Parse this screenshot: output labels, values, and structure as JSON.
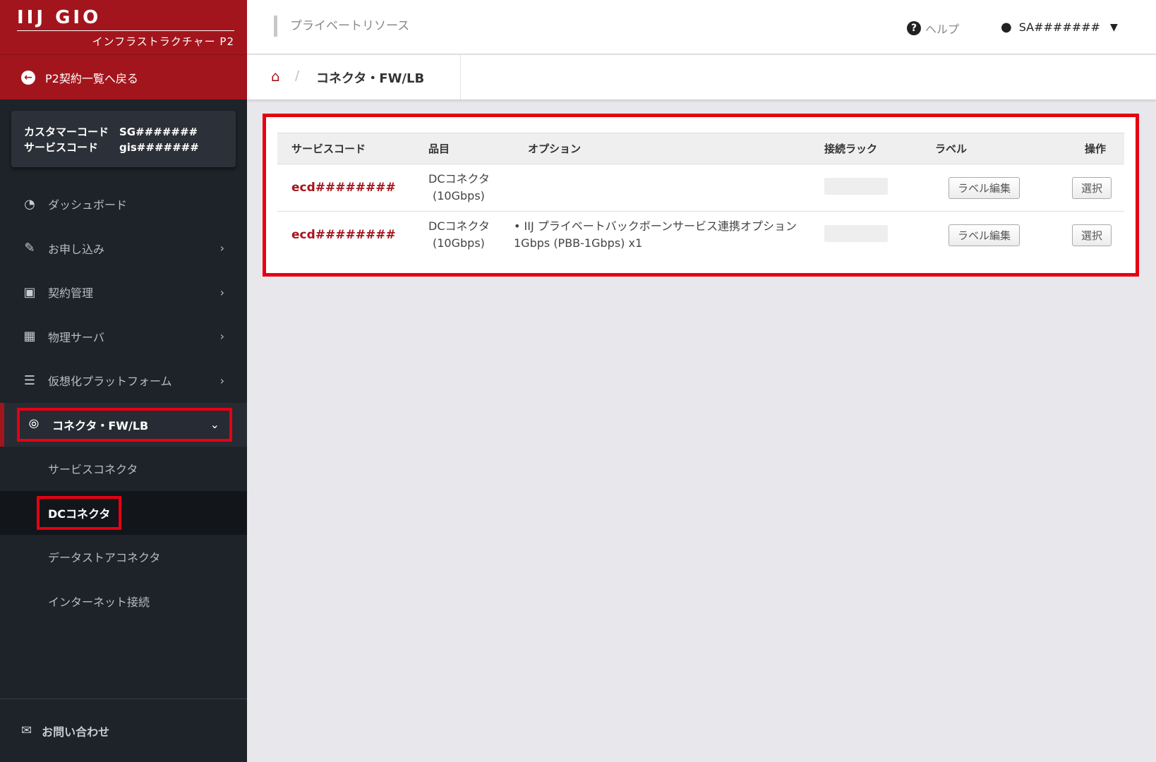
{
  "brand": {
    "logo": "IIJ GIO",
    "subtitle": "インフラストラクチャー P2",
    "back_label": "P2契約一覧へ戻る"
  },
  "codes": {
    "customer_code_label": "カスタマーコード",
    "customer_code": "SG#######",
    "service_code_label": "サービスコード",
    "service_code": "gis#######"
  },
  "nav": {
    "items": [
      {
        "label": "ダッシュボード",
        "icon": "dashboard-icon"
      },
      {
        "label": "お申し込み",
        "icon": "edit-icon"
      },
      {
        "label": "契約管理",
        "icon": "truck-icon"
      },
      {
        "label": "物理サーバ",
        "icon": "building-icon"
      },
      {
        "label": "仮想化プラットフォーム",
        "icon": "server-icon"
      },
      {
        "label": "コネクタ・FW/LB",
        "icon": "share-icon"
      }
    ],
    "sub_items": [
      {
        "label": "サービスコネクタ"
      },
      {
        "label": "DCコネクタ"
      },
      {
        "label": "データストアコネクタ"
      },
      {
        "label": "インターネット接続"
      }
    ],
    "footer_label": "お問い合わせ"
  },
  "header": {
    "title": "プライベートリソース",
    "help_label": "ヘルプ",
    "user_label": "SA#######"
  },
  "breadcrumb": {
    "current": "コネクタ・FW/LB"
  },
  "table": {
    "headers": {
      "service_code": "サービスコード",
      "item": "品目",
      "option": "オプション",
      "rack": "接続ラック",
      "label": "ラベル",
      "operation": "操作"
    },
    "rows": [
      {
        "service_code": "ecd########",
        "item_line1": "DCコネクタ",
        "item_line2": "(10Gbps)",
        "option": "",
        "label_button": "ラベル編集",
        "select_button": "選択"
      },
      {
        "service_code": "ecd########",
        "item_line1": "DCコネクタ",
        "item_line2": "(10Gbps)",
        "option": "IIJ プライベートバックボーンサービス連携オプション 1Gbps (PBB-1Gbps) x1",
        "label_button": "ラベル編集",
        "select_button": "選択"
      }
    ]
  }
}
